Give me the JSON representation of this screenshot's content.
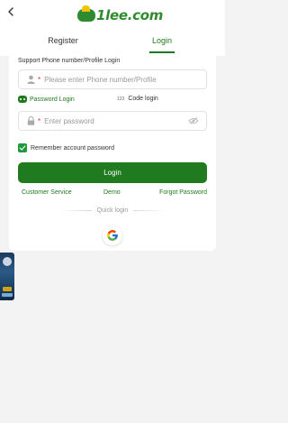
{
  "header": {
    "back_icon": "chevron-left-icon",
    "logo_text": "1lee.com"
  },
  "tabs": [
    {
      "label": "Register",
      "active": false
    },
    {
      "label": "Login",
      "active": true
    }
  ],
  "form": {
    "section_title": "Support Phone number/Profile Login",
    "phone": {
      "icon": "user-icon",
      "required_mark": "*",
      "placeholder": "Please enter Phone number/Profile",
      "value": ""
    },
    "login_modes": {
      "password_login": "Password Login",
      "code_icon_text": "123",
      "code_login": "Code login"
    },
    "password": {
      "icon": "lock-icon",
      "required_mark": "*",
      "placeholder": "Enter password",
      "value": "",
      "toggle_icon": "eye-closed-icon"
    },
    "remember_label": "Remember account password",
    "remember_checked": true,
    "login_button": "Login",
    "links": {
      "customer_service": "Customer Service",
      "demo": "Demo",
      "forgot_password": "Forgot Password"
    },
    "quick_login_label": "Quick login",
    "quick_login_providers": [
      "google-icon"
    ]
  },
  "colors": {
    "accent_green": "#1f7a1f",
    "button_green": "#207a20",
    "checkbox_green": "#1f9a3a",
    "background": "#f3f3f3"
  }
}
